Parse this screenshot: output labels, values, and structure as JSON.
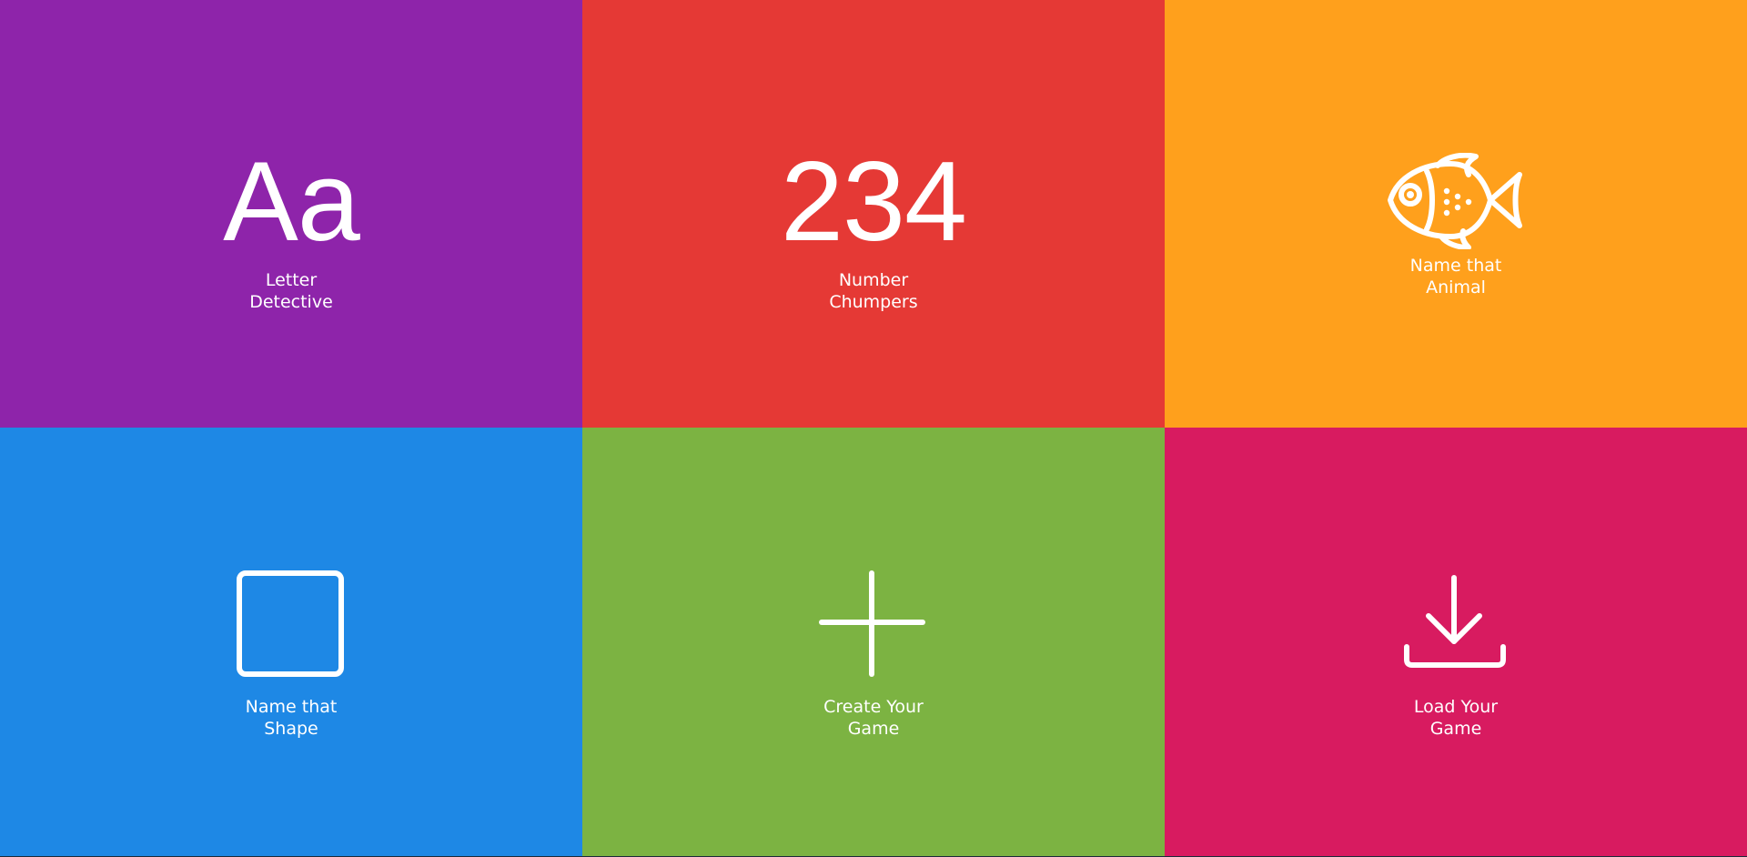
{
  "tiles": [
    {
      "id": "letter-detective",
      "glyph": "Aa",
      "label_line1": "Letter",
      "label_line2": "Detective",
      "color": "#8e24aa"
    },
    {
      "id": "number-chumpers",
      "glyph": "234",
      "label_line1": "Number",
      "label_line2": "Chumpers",
      "color": "#e53935"
    },
    {
      "id": "name-that-animal",
      "icon": "fish-icon",
      "label_line1": "Name that",
      "label_line2": "Animal",
      "color": "#ffa01c"
    },
    {
      "id": "name-that-shape",
      "icon": "square-icon",
      "label_line1": "Name that",
      "label_line2": "Shape",
      "color": "#1e88e5"
    },
    {
      "id": "create-your-game",
      "icon": "plus-icon",
      "label_line1": "Create Your",
      "label_line2": "Game",
      "color": "#7cb342"
    },
    {
      "id": "load-your-game",
      "icon": "download-icon",
      "label_line1": "Load Your",
      "label_line2": "Game",
      "color": "#d81b60"
    }
  ]
}
